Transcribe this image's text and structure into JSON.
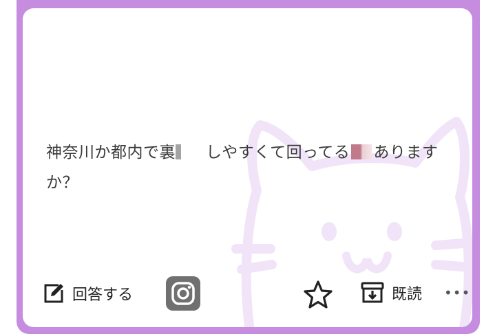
{
  "card": {
    "question_text_1": "神奈川か都内で裏",
    "question_text_2": "しやすくて回ってる",
    "question_text_3": "ありますか？",
    "frame_color": "#c58ce0"
  },
  "toolbar": {
    "answer_label": "回答する",
    "answer_icon": "edit-icon",
    "instagram_icon": "instagram-icon",
    "star_icon": "star-icon",
    "read_label": "既読",
    "read_icon": "archive-icon",
    "more_label": "•••"
  }
}
